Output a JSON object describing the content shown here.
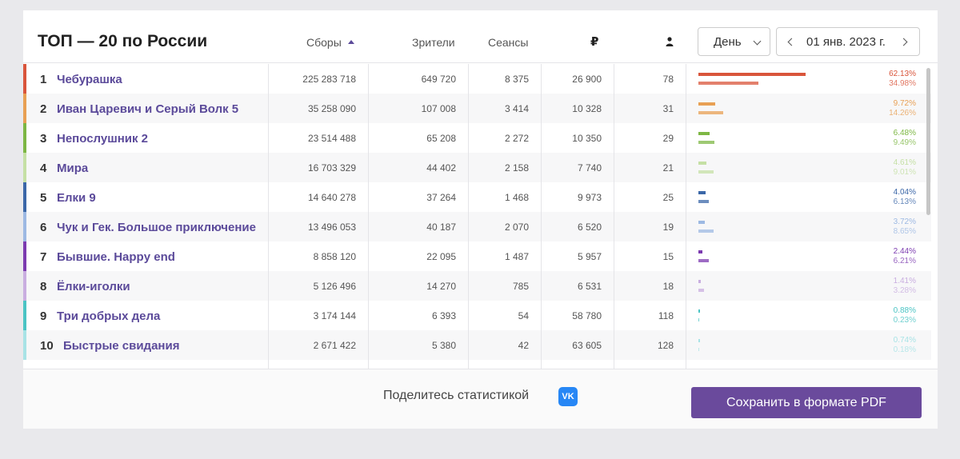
{
  "header": {
    "title": "ТОП — 20 по России",
    "columns": {
      "gross": "Сборы",
      "viewers": "Зрители",
      "sessions": "Сеансы",
      "ruble": "₽"
    },
    "period_select": "День",
    "date": "01 янв. 2023 г."
  },
  "rows": [
    {
      "rank": "1",
      "title": "Чебурашка",
      "gross": "225 283 718",
      "viewers": "649 720",
      "sessions": "8 375",
      "avg": "26 900",
      "per_session": "78",
      "share1": "62.13%",
      "share2": "34.98%",
      "share1_value": 62.13,
      "share2_value": 34.98,
      "color": "#d9553b"
    },
    {
      "rank": "2",
      "title": "Иван Царевич и Серый Волк 5",
      "gross": "35 258 090",
      "viewers": "107 008",
      "sessions": "3 414",
      "avg": "10 328",
      "per_session": "31",
      "share1": "9.72%",
      "share2": "14.26%",
      "share1_value": 9.72,
      "share2_value": 14.26,
      "color": "#e8a054"
    },
    {
      "rank": "3",
      "title": "Непослушник 2",
      "gross": "23 514 488",
      "viewers": "65 208",
      "sessions": "2 272",
      "avg": "10 350",
      "per_session": "29",
      "share1": "6.48%",
      "share2": "9.49%",
      "share1_value": 6.48,
      "share2_value": 9.49,
      "color": "#7db744"
    },
    {
      "rank": "4",
      "title": "Мира",
      "gross": "16 703 329",
      "viewers": "44 402",
      "sessions": "2 158",
      "avg": "7 740",
      "per_session": "21",
      "share1": "4.61%",
      "share2": "9.01%",
      "share1_value": 4.61,
      "share2_value": 9.01,
      "color": "#c5e0a5"
    },
    {
      "rank": "5",
      "title": "Елки 9",
      "gross": "14 640 278",
      "viewers": "37 264",
      "sessions": "1 468",
      "avg": "9 973",
      "per_session": "25",
      "share1": "4.04%",
      "share2": "6.13%",
      "share1_value": 4.04,
      "share2_value": 6.13,
      "color": "#3b67a8"
    },
    {
      "rank": "6",
      "title": "Чук и Гек. Большое приключение",
      "gross": "13 496 053",
      "viewers": "40 187",
      "sessions": "2 070",
      "avg": "6 520",
      "per_session": "19",
      "share1": "3.72%",
      "share2": "8.65%",
      "share1_value": 3.72,
      "share2_value": 8.65,
      "color": "#9db9e3"
    },
    {
      "rank": "7",
      "title": "Бывшие. Happy end",
      "gross": "8 858 120",
      "viewers": "22 095",
      "sessions": "1 487",
      "avg": "5 957",
      "per_session": "15",
      "share1": "2.44%",
      "share2": "6.21%",
      "share1_value": 2.44,
      "share2_value": 6.21,
      "color": "#7c3bb0"
    },
    {
      "rank": "8",
      "title": "Ёлки-иголки",
      "gross": "5 126 496",
      "viewers": "14 270",
      "sessions": "785",
      "avg": "6 531",
      "per_session": "18",
      "share1": "1.41%",
      "share2": "3.28%",
      "share1_value": 1.41,
      "share2_value": 3.28,
      "color": "#c9aee0"
    },
    {
      "rank": "9",
      "title": "Три добрых дела",
      "gross": "3 174 144",
      "viewers": "6 393",
      "sessions": "54",
      "avg": "58 780",
      "per_session": "118",
      "share1": "0.88%",
      "share2": "0.23%",
      "share1_value": 0.88,
      "share2_value": 0.23,
      "color": "#4bc4c4"
    },
    {
      "rank": "10",
      "title": "Быстрые свидания",
      "gross": "2 671 422",
      "viewers": "5 380",
      "sessions": "42",
      "avg": "63 605",
      "per_session": "128",
      "share1": "0.74%",
      "share2": "0.18%",
      "share1_value": 0.74,
      "share2_value": 0.18,
      "color": "#a8e3e6"
    }
  ],
  "footer": {
    "share_text": "Поделитесь статистикой",
    "vk_label": "VK",
    "pdf_button": "Сохранить в формате PDF"
  }
}
